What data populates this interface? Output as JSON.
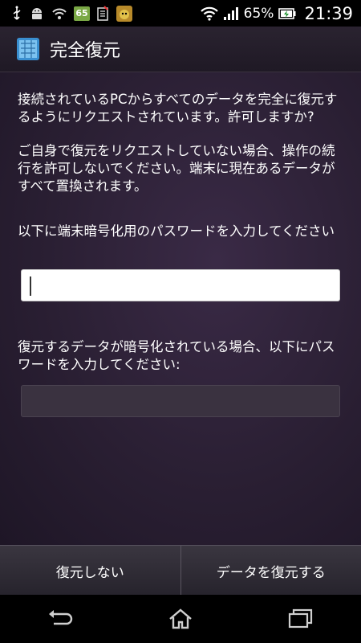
{
  "status_bar": {
    "notification_icons": [
      "usb-icon",
      "android-debug-icon",
      "wifi-question-icon",
      "app-update-icon",
      "sim-icon",
      "bug-app-icon"
    ],
    "badge_number": "65",
    "battery_percent": "65%",
    "time": "21:39"
  },
  "title_bar": {
    "title": "完全復元"
  },
  "content": {
    "paragraph1": "接続されているPCからすべてのデータを完全に復元するようにリクエストされています。許可しますか?",
    "paragraph2": "ご自身で復元をリクエストしていない場合、操作の続行を許可しないでください。端末に現在あるデータがすべて置換されます。",
    "password_label": "以下に端末暗号化用のパスワードを入力してください",
    "password_value": "",
    "backup_password_label": "復元するデータが暗号化されている場合、以下にパスワードを入力してください:",
    "backup_password_value": ""
  },
  "buttons": {
    "deny": "復元しない",
    "confirm": "データを復元する"
  },
  "nav": {
    "icons": [
      "back-icon",
      "home-icon",
      "recent-apps-icon"
    ]
  }
}
